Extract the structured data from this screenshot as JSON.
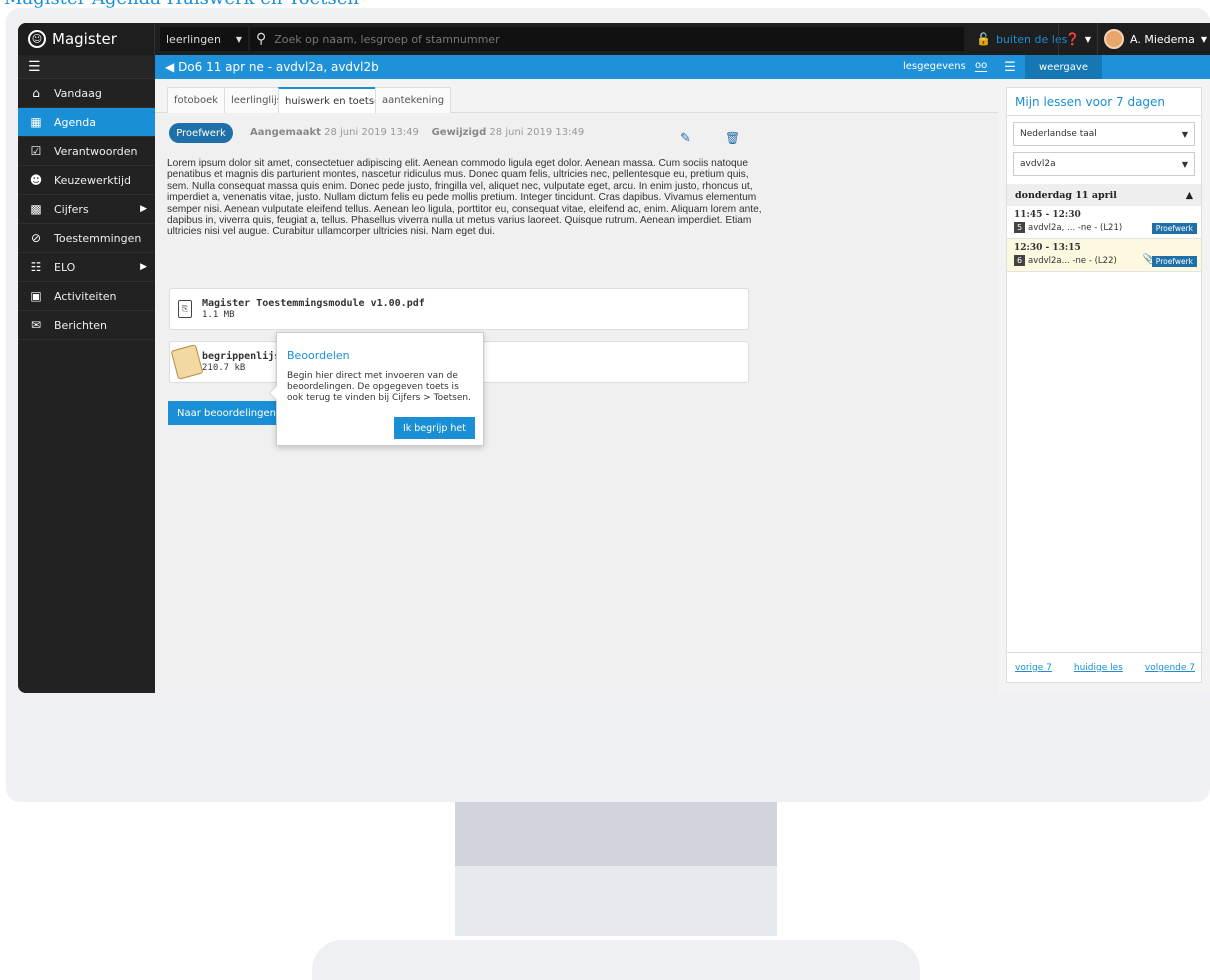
{
  "page_header": "Magister Agenda Huiswerk en Toetsen",
  "app": {
    "name": "Magister"
  },
  "topbar": {
    "scope": "leerlingen",
    "search_placeholder": "Zoek op naam, lesgroep of stamnummer",
    "lock_label": "buiten de les",
    "user_name": "A. Miedema"
  },
  "sidebar": {
    "items": [
      {
        "label": "Vandaag",
        "icon": "home-icon"
      },
      {
        "label": "Agenda",
        "icon": "calendar-icon",
        "active": true
      },
      {
        "label": "Verantwoorden",
        "icon": "check-calendar-icon"
      },
      {
        "label": "Keuzewerktijd",
        "icon": "users-icon"
      },
      {
        "label": "Cijfers",
        "icon": "grid-icon"
      },
      {
        "label": "Toestemmingen",
        "icon": "eye-slash-icon"
      },
      {
        "label": "ELO",
        "icon": "group-icon"
      },
      {
        "label": "Activiteiten",
        "icon": "calendar-plus-icon"
      },
      {
        "label": "Berichten",
        "icon": "envelope-icon"
      }
    ]
  },
  "header": {
    "breadcrumb": "Do6 11 apr ne - avdvl2a, avdvl2b",
    "lesgegevens": "lesgegevens",
    "view_label": "weergave"
  },
  "tabs": [
    {
      "label": "fotoboek"
    },
    {
      "label": "leerlinglijst"
    },
    {
      "label": "huiswerk en toetsen",
      "active": true
    },
    {
      "label": "aantekening"
    }
  ],
  "item": {
    "type_label": "Proefwerk",
    "created_label": "Aangemaakt",
    "created_date": "28 juni 2019 13:49",
    "modified_label": "Gewijzigd",
    "modified_date": "28 juni 2019 13:49",
    "body": "Lorem ipsum dolor sit amet, consectetuer adipiscing elit. Aenean commodo ligula eget dolor. Aenean massa. Cum sociis natoque penatibus et magnis dis parturient montes, nascetur ridiculus mus. Donec quam felis, ultricies nec, pellentesque eu, pretium quis, sem. Nulla consequat massa quis enim. Donec pede justo, fringilla vel, aliquet nec, vulputate eget, arcu. In enim justo, rhoncus ut, imperdiet a, venenatis vitae, justo. Nullam dictum felis eu pede mollis pretium. Integer tincidunt. Cras dapibus. Vivamus elementum semper nisi. Aenean vulputate eleifend tellus. Aenean leo ligula, porttitor eu, consequat vitae, eleifend ac, enim. Aliquam lorem ante, dapibus in, viverra quis, feugiat a, tellus. Phasellus viverra nulla ut metus varius laoreet. Quisque rutrum. Aenean imperdiet. Etiam ultricies nisi vel augue. Curabitur ullamcorper ultricies nisi. Nam eget dui.",
    "files": [
      {
        "name": "Magister Toestemmingsmodule v1.00.pdf",
        "size": "1.1 MB"
      },
      {
        "name": "begrippenlijst-1.",
        "size": "210.7 kB"
      }
    ],
    "review_button": "Naar beoordelingen"
  },
  "popover": {
    "title": "Beoordelen",
    "text": "Begin hier direct met invoeren van de beoordelingen. De opgegeven toets is ook terug te vinden bij Cijfers > Toetsen.",
    "button": "Ik begrijp het"
  },
  "right_panel": {
    "title": "Mijn lessen voor 7 dagen",
    "subject": "Nederlandse taal",
    "group": "avdvl2a",
    "day": "donderdag 11 april",
    "lessons": [
      {
        "time": "11:45 - 12:30",
        "hour": "5",
        "name": "avdvl2a, ... -ne - (L21)",
        "tag": "Proefwerk"
      },
      {
        "time": "12:30 - 13:15",
        "hour": "6",
        "name": "avdvl2a... -ne - (L22)",
        "tag": "Proefwerk"
      }
    ],
    "prev": "vorige 7",
    "current": "huidige les",
    "next": "volgende 7"
  },
  "colors": {
    "accent": "#1a8fd6",
    "dark": "#1e1e1e",
    "button_dark": "#1f6fa8"
  }
}
